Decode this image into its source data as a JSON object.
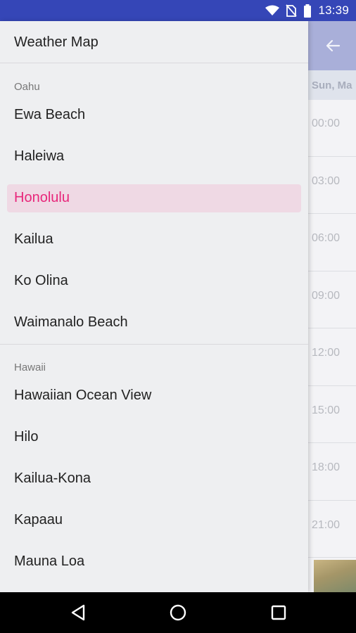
{
  "status_bar": {
    "time": "13:39",
    "icons": [
      "wifi-icon",
      "no-sim-icon",
      "battery-icon"
    ]
  },
  "background": {
    "day_label": "Sun, Ma",
    "times": [
      "00:00",
      "03:00",
      "06:00",
      "09:00",
      "12:00",
      "15:00",
      "18:00",
      "21:00"
    ]
  },
  "drawer": {
    "title": "Weather Map",
    "sections": [
      {
        "header": "Oahu",
        "items": [
          "Ewa Beach",
          "Haleiwa",
          "Honolulu",
          "Kailua",
          "Ko Olina",
          "Waimanalo Beach"
        ]
      },
      {
        "header": "Hawaii",
        "items": [
          "Hawaiian Ocean View",
          "Hilo",
          "Kailua-Kona",
          "Kapaau",
          "Mauna Loa"
        ]
      }
    ],
    "selected_item": "Honolulu"
  },
  "colors": {
    "status_bar": "#3546b7",
    "selected_text": "#e8267a",
    "selected_background": "#efd9e4"
  },
  "nav_bar": {
    "icons": [
      "back-icon",
      "home-icon",
      "recents-icon"
    ]
  }
}
